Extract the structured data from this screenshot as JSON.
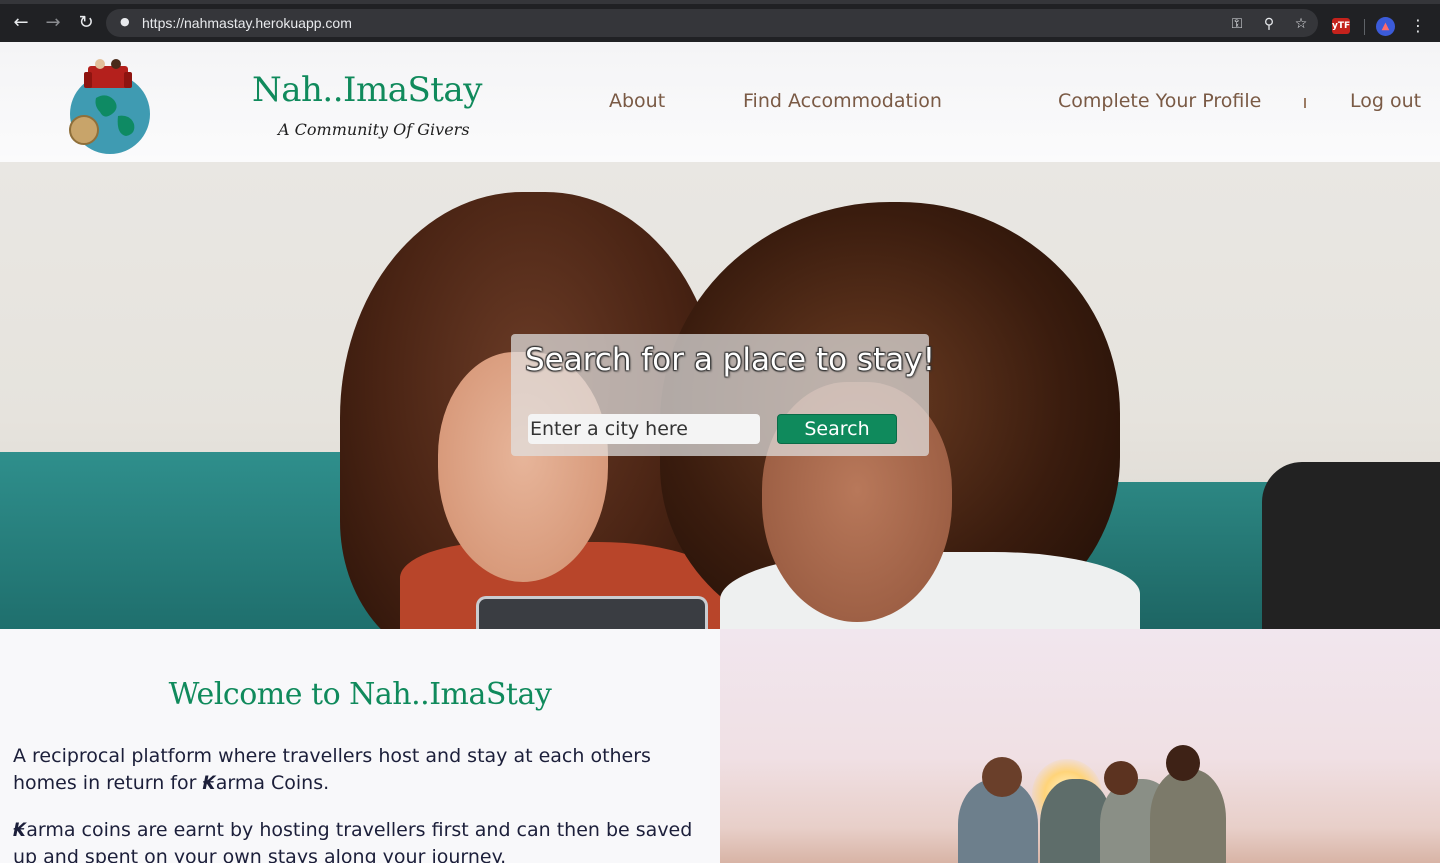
{
  "browser": {
    "url": "https://nahmastay.herokuapp.com",
    "extension_badge": "yTF"
  },
  "header": {
    "brand_title": "Nah..ImaStay",
    "tagline": "A Community Of Givers",
    "nav": {
      "about": "About",
      "find": "Find Accommodation",
      "profile": "Complete Your Profile",
      "logout": "Log out"
    }
  },
  "hero": {
    "heading": "Search for a place to stay!",
    "search_placeholder": "Enter a city here",
    "search_button": "Search"
  },
  "intro": {
    "title": "Welcome to Nah..ImaStay",
    "paragraph1_a": "A reciprocal platform where travellers host and stay at each others homes in return for ",
    "karma_glyph": "₭",
    "paragraph1_b": "arma Coins.",
    "paragraph2": "arma coins are earnt by hosting travellers first and can then be saved up and spent on your own stays along your journey."
  },
  "colors": {
    "brand_green": "#108a5c",
    "nav_brown": "#7a5a45",
    "body_text": "#1c1f3a"
  }
}
